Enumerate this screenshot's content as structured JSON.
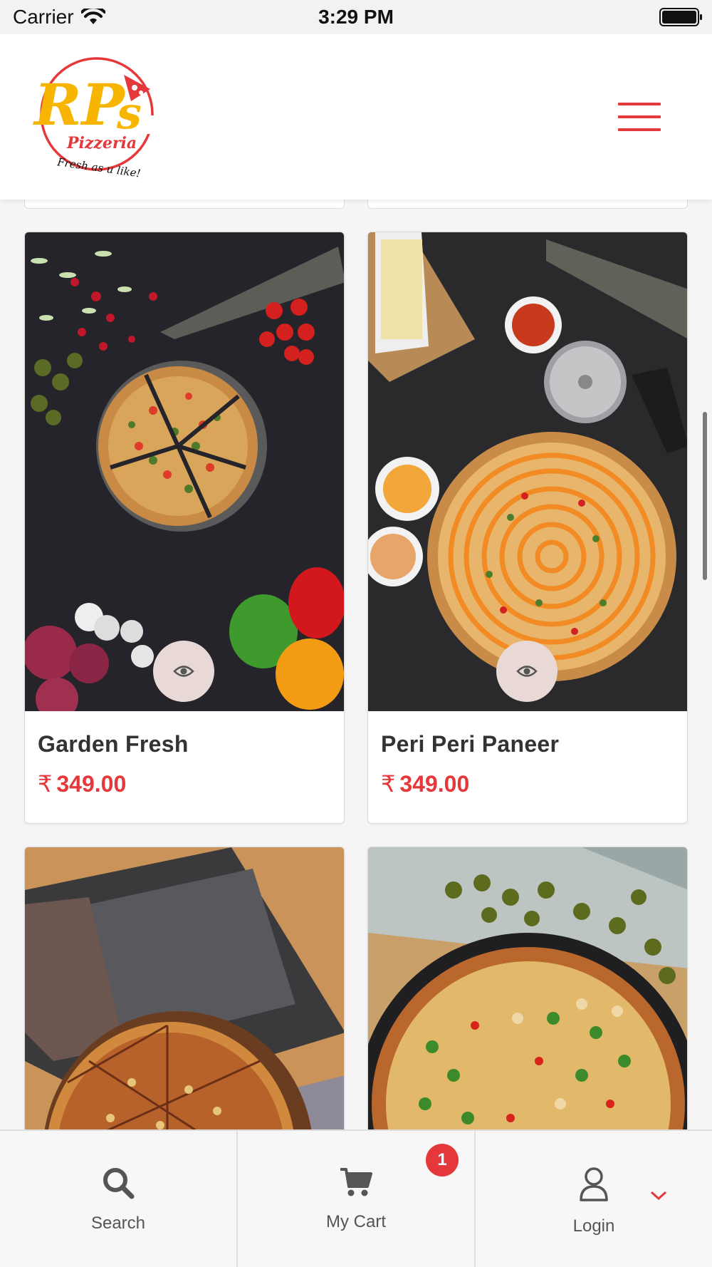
{
  "status_bar": {
    "carrier": "Carrier",
    "time": "3:29 PM"
  },
  "brand": {
    "logo_main": "RP's",
    "logo_sub": "Pizzeria",
    "logo_tagline": "Fresh as u like!",
    "accent_color": "#e5383b",
    "logo_yellow": "#f7b500"
  },
  "products": [
    {
      "name": "Garden Fresh",
      "currency": "₹",
      "price": "349.00"
    },
    {
      "name": "Peri Peri Paneer",
      "currency": "₹",
      "price": "349.00"
    }
  ],
  "bottom_nav": {
    "search": {
      "label": "Search",
      "icon": "search-icon"
    },
    "cart": {
      "label": "My Cart",
      "icon": "cart-icon",
      "badge": "1"
    },
    "login": {
      "label": "Login",
      "icon": "user-icon"
    }
  }
}
